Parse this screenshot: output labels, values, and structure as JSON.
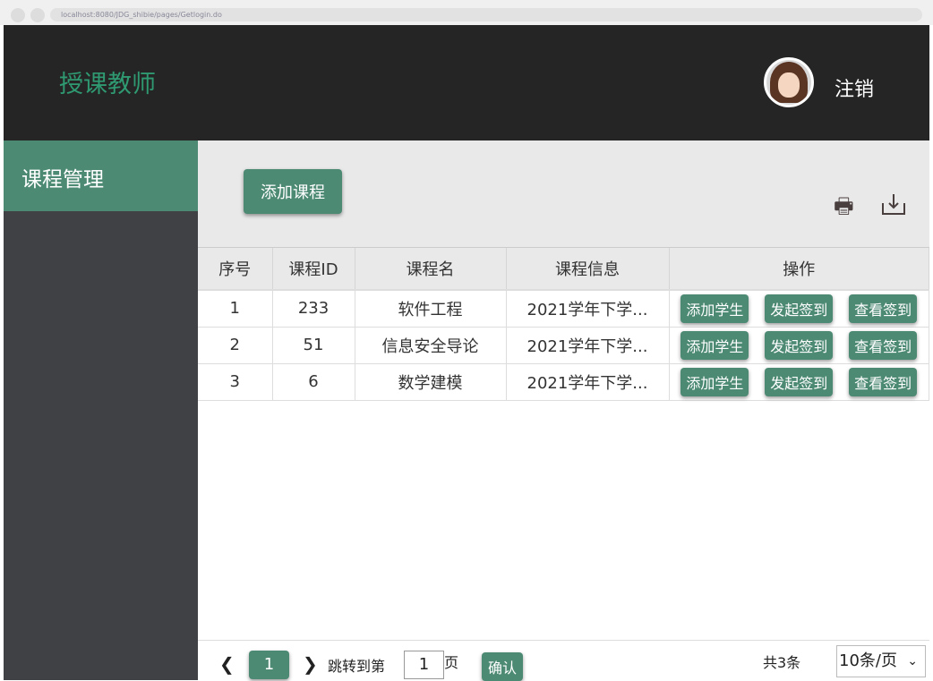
{
  "browser": {
    "url": "localhost:8080/JDG_shibie/pages/Getlogin.do"
  },
  "header": {
    "title": "授课教师",
    "logout": "注销"
  },
  "sidebar": {
    "items": [
      {
        "label": "课程管理"
      }
    ]
  },
  "toolbar": {
    "add_course": "添加课程",
    "icons": [
      "print-icon",
      "download-icon"
    ]
  },
  "table": {
    "columns": [
      "序号",
      "课程ID",
      "课程名",
      "课程信息",
      "操作"
    ],
    "rows": [
      {
        "no": "1",
        "id": "233",
        "name": "软件工程",
        "info": "2021学年下学..."
      },
      {
        "no": "2",
        "id": "51",
        "name": "信息安全导论",
        "info": "2021学年下学..."
      },
      {
        "no": "3",
        "id": "6",
        "name": "数学建模",
        "info": "2021学年下学..."
      }
    ],
    "actions": [
      "添加学生",
      "发起签到",
      "查看签到"
    ]
  },
  "pagination": {
    "prev": "❮",
    "current": "1",
    "next": "❯",
    "jump_label": "跳转到第",
    "jump_value": "1",
    "page_suffix": "页",
    "confirm": "确认",
    "total": "共3条",
    "page_size": "10条/页"
  },
  "colors": {
    "accent": "#4d8a74",
    "header_bg": "#252525",
    "sidebar_bg": "#404145",
    "title": "#2f9a72"
  }
}
